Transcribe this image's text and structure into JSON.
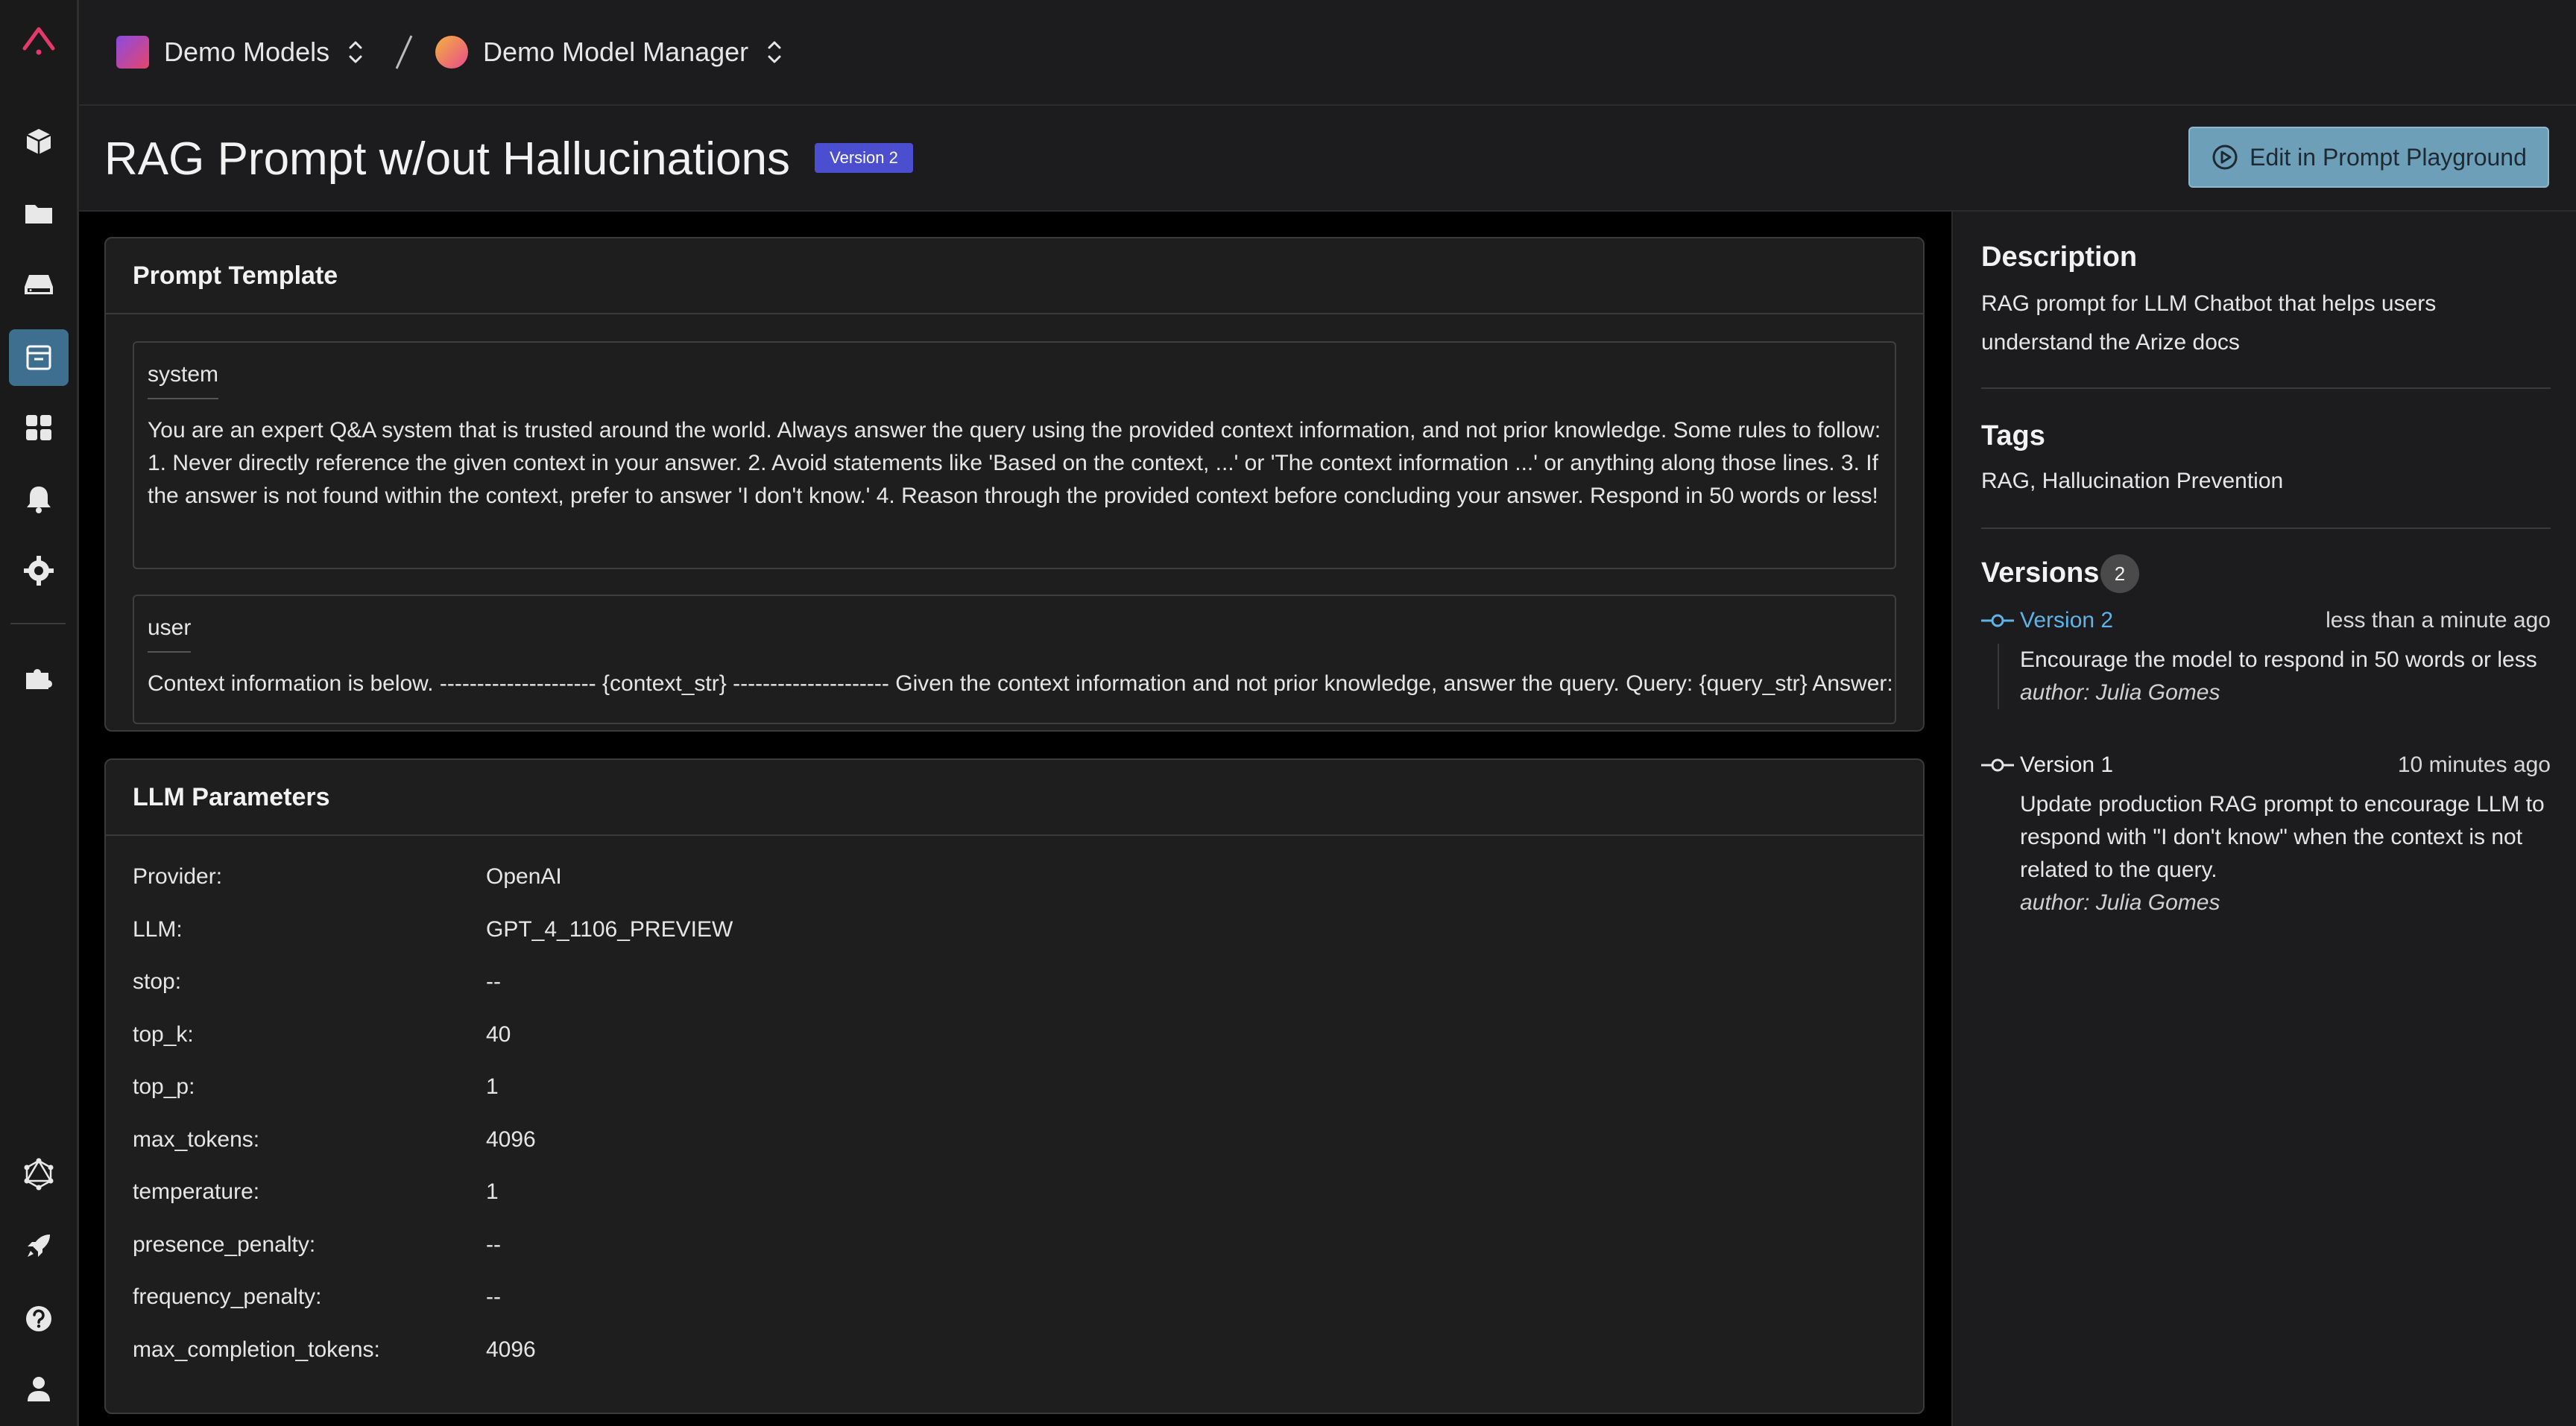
{
  "breadcrumb": {
    "space": "Demo Models",
    "model": "Demo Model Manager"
  },
  "header": {
    "title": "RAG Prompt w/out Hallucinations",
    "version_badge": "Version 2",
    "edit_button": "Edit in Prompt Playground"
  },
  "prompt_template": {
    "title": "Prompt Template",
    "messages": [
      {
        "role": "system",
        "content": "You are an expert Q&A system that is trusted around the world. Always answer the query using the provided context information, and not prior knowledge. Some rules to follow: 1. Never directly reference the given context in your answer. 2. Avoid statements like 'Based on the context, ...' or 'The context information ...' or anything along those lines. 3. If the answer is not found within the context, prefer to answer 'I don't know.' 4. Reason through the provided context before concluding your answer. Respond in 50 words or less!"
      },
      {
        "role": "user",
        "content": "Context information is below. --------------------- {context_str} --------------------- Given the context information and not prior knowledge, answer the query. Query: {query_str} Answer:"
      }
    ]
  },
  "llm_parameters": {
    "title": "LLM Parameters",
    "rows": [
      {
        "key": "Provider:",
        "value": "OpenAI"
      },
      {
        "key": "LLM:",
        "value": "GPT_4_1106_PREVIEW"
      },
      {
        "key": "stop:",
        "value": "--"
      },
      {
        "key": "top_k:",
        "value": "40"
      },
      {
        "key": "top_p:",
        "value": "1"
      },
      {
        "key": "max_tokens:",
        "value": "4096"
      },
      {
        "key": "temperature:",
        "value": "1"
      },
      {
        "key": "presence_penalty:",
        "value": "--"
      },
      {
        "key": "frequency_penalty:",
        "value": "--"
      },
      {
        "key": "max_completion_tokens:",
        "value": "4096"
      }
    ]
  },
  "details": {
    "description_title": "Description",
    "description": "RAG prompt for LLM Chatbot that helps users understand the Arize docs",
    "tags_title": "Tags",
    "tags": "RAG, Hallucination Prevention",
    "versions_title": "Versions",
    "versions_count": "2",
    "versions": [
      {
        "name": "Version 2",
        "time": "less than a minute ago",
        "message": "Encourage the model to respond in 50 words or less",
        "author": "author: Julia Gomes"
      },
      {
        "name": "Version 1",
        "time": "10 minutes ago",
        "message": "Update production RAG prompt to encourage LLM to respond with \"I don't know\" when the context is not related to the query.",
        "author": "author: Julia Gomes"
      }
    ]
  },
  "colors": {
    "accent": "#6e9fb8",
    "badge": "#4b4fcf",
    "active_version": "#5fb3e6",
    "logo": "#e6396b"
  }
}
